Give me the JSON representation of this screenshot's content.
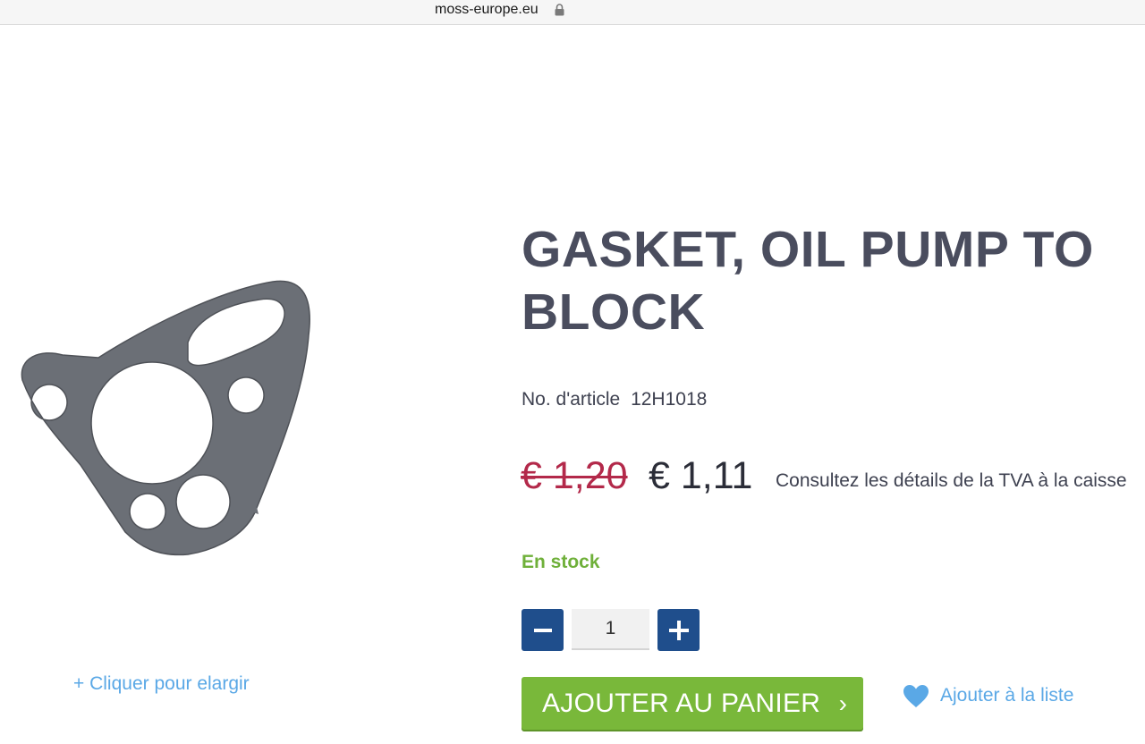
{
  "browser": {
    "url_host": "moss-europe.eu"
  },
  "product": {
    "title": "GASKET, OIL PUMP TO BLOCK",
    "sku_label": "No. d'article",
    "sku_value": "12H1018",
    "old_price": "€ 1,20",
    "new_price": "€ 1,11",
    "vat_note": "Consultez les détails de la TVA à la caisse",
    "stock_status": "En stock",
    "image_icon": "gasket-image",
    "enlarge_label": "+ Cliquer pour elargir"
  },
  "quantity": {
    "value": "1",
    "minus_icon": "minus-icon",
    "plus_icon": "plus-icon"
  },
  "actions": {
    "add_to_cart_label": "AJOUTER AU PANIER",
    "add_to_cart_icon": "chevron-right-icon",
    "wishlist_label": "Ajouter à la liste",
    "wishlist_icon": "heart-icon"
  },
  "colors": {
    "title": "#4a4d5e",
    "old_price": "#b3294a",
    "stock": "#6fb03a",
    "qty_button": "#1f4e8c",
    "cart_button": "#79b83a",
    "link": "#5aa8e6"
  }
}
